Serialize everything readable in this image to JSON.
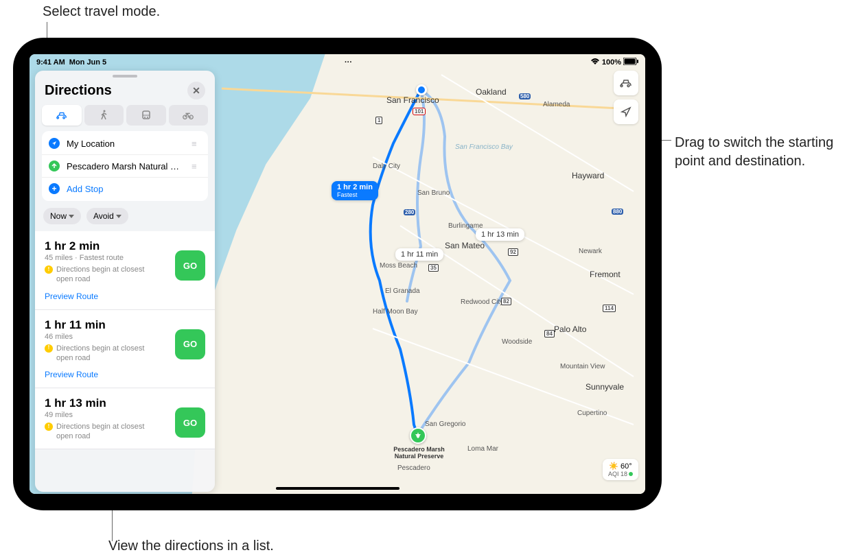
{
  "annotations": {
    "travel_mode": "Select travel mode.",
    "drag": "Drag to switch the starting point and destination.",
    "list": "View the directions in a list."
  },
  "status": {
    "time": "9:41 AM",
    "date": "Mon Jun 5",
    "battery": "100%"
  },
  "panel": {
    "title": "Directions",
    "stops": {
      "origin": "My Location",
      "destination": "Pescadero Marsh Natural Pres…",
      "add": "Add Stop"
    },
    "filters": {
      "now": "Now",
      "avoid": "Avoid"
    }
  },
  "routes": [
    {
      "time": "1 hr 2 min",
      "meta": "45 miles · Fastest route",
      "warn": "Directions begin at closest open road",
      "go": "GO",
      "preview": "Preview Route"
    },
    {
      "time": "1 hr 11 min",
      "meta": "46 miles",
      "warn": "Directions begin at closest open road",
      "go": "GO",
      "preview": "Preview Route"
    },
    {
      "time": "1 hr 13 min",
      "meta": "49 miles",
      "warn": "Directions begin at closest open road",
      "go": "GO",
      "preview": "Preview Route"
    }
  ],
  "map": {
    "badges": {
      "primary": {
        "time": "1 hr 2 min",
        "sub": "Fastest"
      },
      "alt1": "1 hr 11 min",
      "alt2": "1 hr 13 min"
    },
    "cities": {
      "sf": "San Francisco",
      "oakland": "Oakland",
      "daly": "Daly City",
      "sanbruno": "San Bruno",
      "sanmateo": "San Mateo",
      "hayward": "Hayward",
      "alameda": "Alameda",
      "fremont": "Fremont",
      "paloalto": "Palo Alto",
      "mtview": "Mountain View",
      "sunnyvale": "Sunnyvale",
      "cupertino": "Cupertino",
      "redwood": "Redwood City",
      "newark": "Newark",
      "woodside": "Woodside",
      "hmb": "Half Moon Bay",
      "elgranada": "El Granada",
      "mossbeach": "Moss Beach",
      "pescadero": "Pescadero",
      "sangregorio": "San Gregorio",
      "lomamar": "Loma Mar",
      "sfbay": "San Francisco Bay",
      "burlingame": "Burlingame"
    },
    "dest_label": "Pescadero Marsh Natural Preserve",
    "weather": {
      "temp": "60°",
      "aqi": "AQI 18"
    },
    "shields": {
      "101": "101",
      "280": "280",
      "580": "580",
      "92": "92",
      "880": "880",
      "84": "84",
      "1": "1",
      "35": "35",
      "114": "114",
      "82": "82"
    }
  }
}
